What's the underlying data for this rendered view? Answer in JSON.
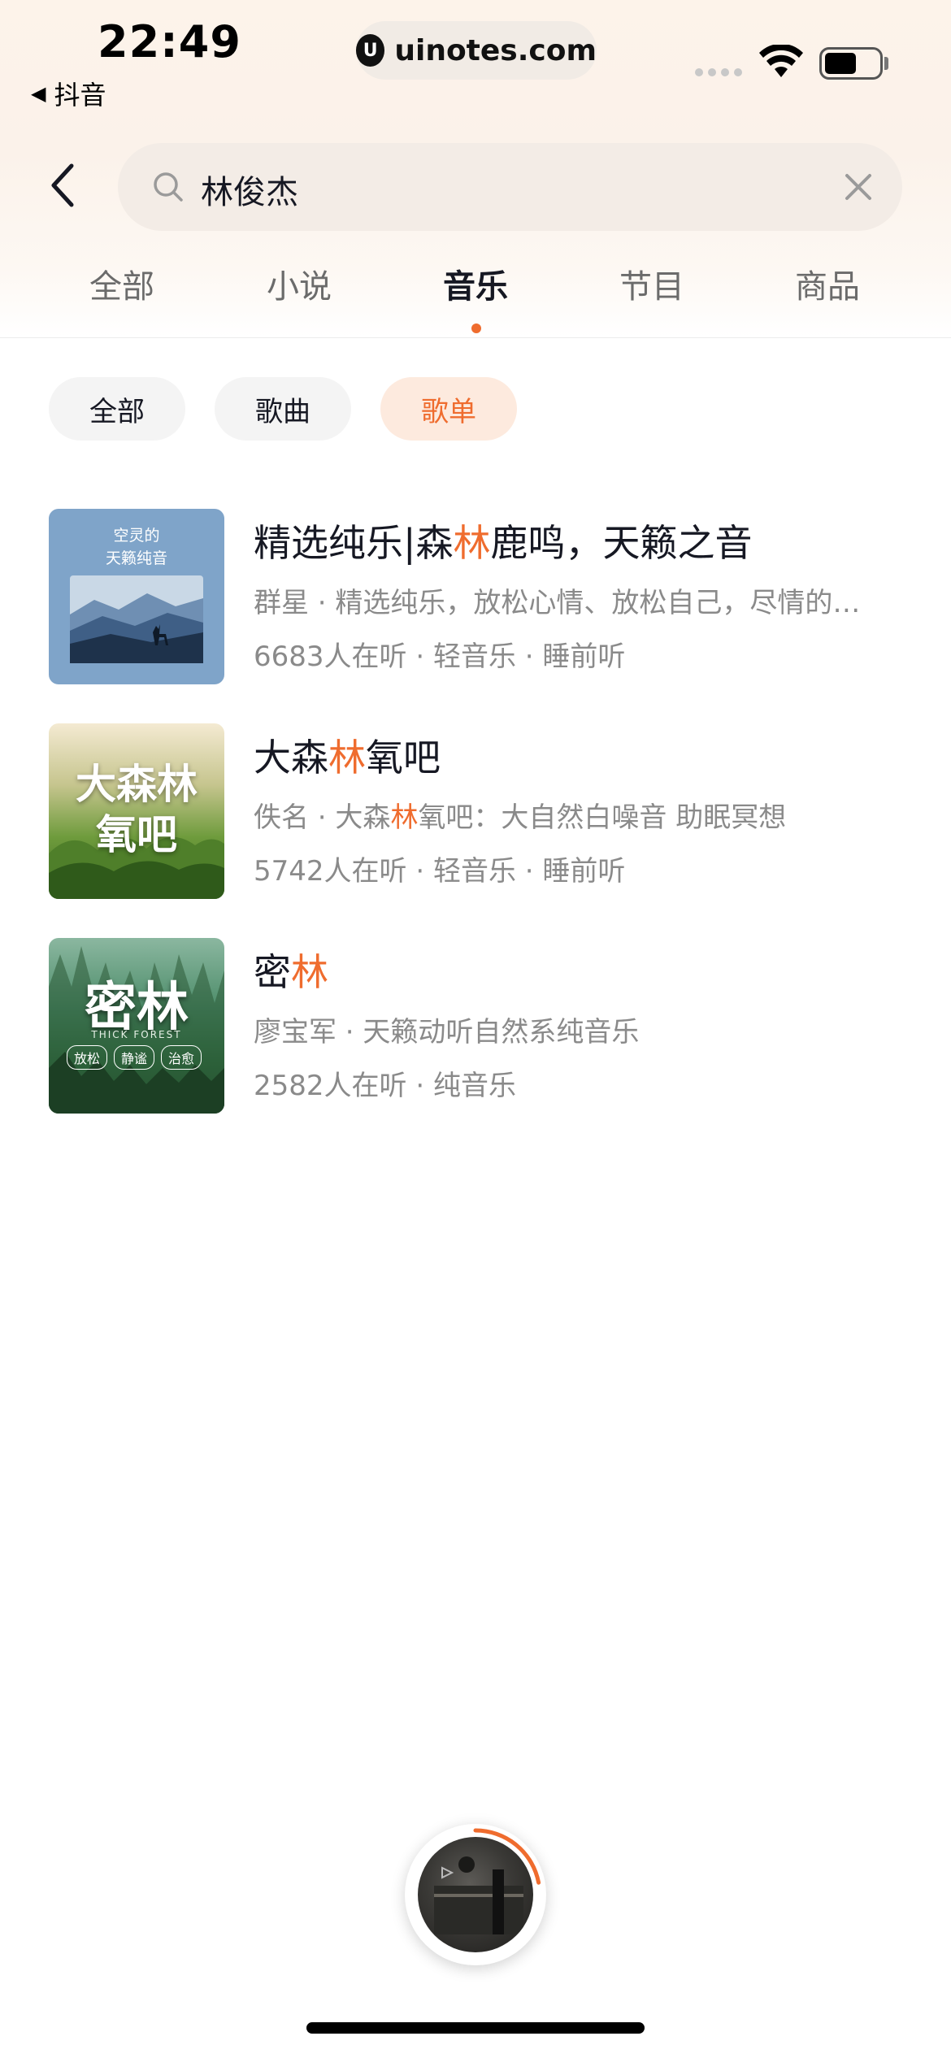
{
  "status_bar": {
    "time": "22:49",
    "back_app": "抖音",
    "back_glyph": "◀",
    "url": "uinotes.com",
    "url_logo": "U"
  },
  "search": {
    "query": "林俊杰",
    "icons": {
      "back": "chevron-left-icon",
      "search": "search-icon",
      "clear": "close-icon"
    }
  },
  "tabs": [
    {
      "label": "全部",
      "active": false
    },
    {
      "label": "小说",
      "active": false
    },
    {
      "label": "音乐",
      "active": true
    },
    {
      "label": "节目",
      "active": false
    },
    {
      "label": "商品",
      "active": false
    }
  ],
  "filters": [
    {
      "label": "全部",
      "active": false
    },
    {
      "label": "歌曲",
      "active": false
    },
    {
      "label": "歌单",
      "active": true
    }
  ],
  "colors": {
    "accent": "#ef6c2e",
    "text_primary": "#161823",
    "text_secondary": "#8a8a8a"
  },
  "playlists": [
    {
      "title_pre": "精选纯乐|森",
      "title_hl": "林",
      "title_post": "鹿鸣，天籁之音",
      "subtitle_pre": "群星 · 精选纯乐，放松心情、放松自己，尽情的…",
      "subtitle_hl": "",
      "subtitle_post": "",
      "meta": "6683人在听 · 轻音乐 · 睡前听",
      "cover_text_1": "空灵的",
      "cover_text_2": "天籁纯音"
    },
    {
      "title_pre": "大森",
      "title_hl": "林",
      "title_post": "氧吧",
      "subtitle_pre": "佚名 · 大森",
      "subtitle_hl": "林",
      "subtitle_post": "氧吧：大自然白噪音 助眠冥想",
      "meta": "5742人在听 · 轻音乐 · 睡前听",
      "cover_text_1": "大森林",
      "cover_text_2": "氧吧"
    },
    {
      "title_pre": "密",
      "title_hl": "林",
      "title_post": "",
      "subtitle_pre": "廖宝军 · 天籁动听自然系纯音乐",
      "subtitle_hl": "",
      "subtitle_post": "",
      "meta": "2582人在听 · 纯音乐",
      "cover_text_1": "密林",
      "cover_text_2": "THICK FOREST",
      "cover_tags": [
        "放松",
        "静谧",
        "治愈"
      ]
    }
  ],
  "player": {
    "progress": 0.22
  }
}
